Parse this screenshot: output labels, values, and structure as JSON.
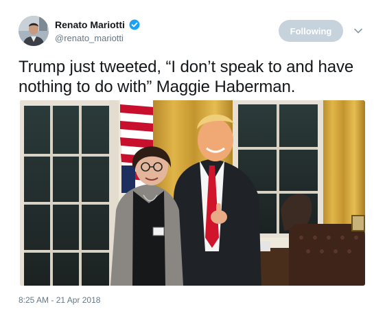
{
  "author": {
    "name": "Renato Mariotti",
    "handle": "@renato_mariotti",
    "verified": true,
    "avatar_icon": "user-avatar"
  },
  "follow_button": {
    "label": "Following",
    "bg_color": "#c6d2dc"
  },
  "menu": {
    "icon": "chevron-down-icon"
  },
  "tweet": {
    "text": "Trump just tweeted, “I don’t speak to and have nothing to do with” Maggie Haberman.",
    "timestamp": "8:25 AM - 21 Apr 2018"
  },
  "colors": {
    "verified_blue": "#1da1f2",
    "text_primary": "#14171a",
    "text_secondary": "#657786"
  }
}
